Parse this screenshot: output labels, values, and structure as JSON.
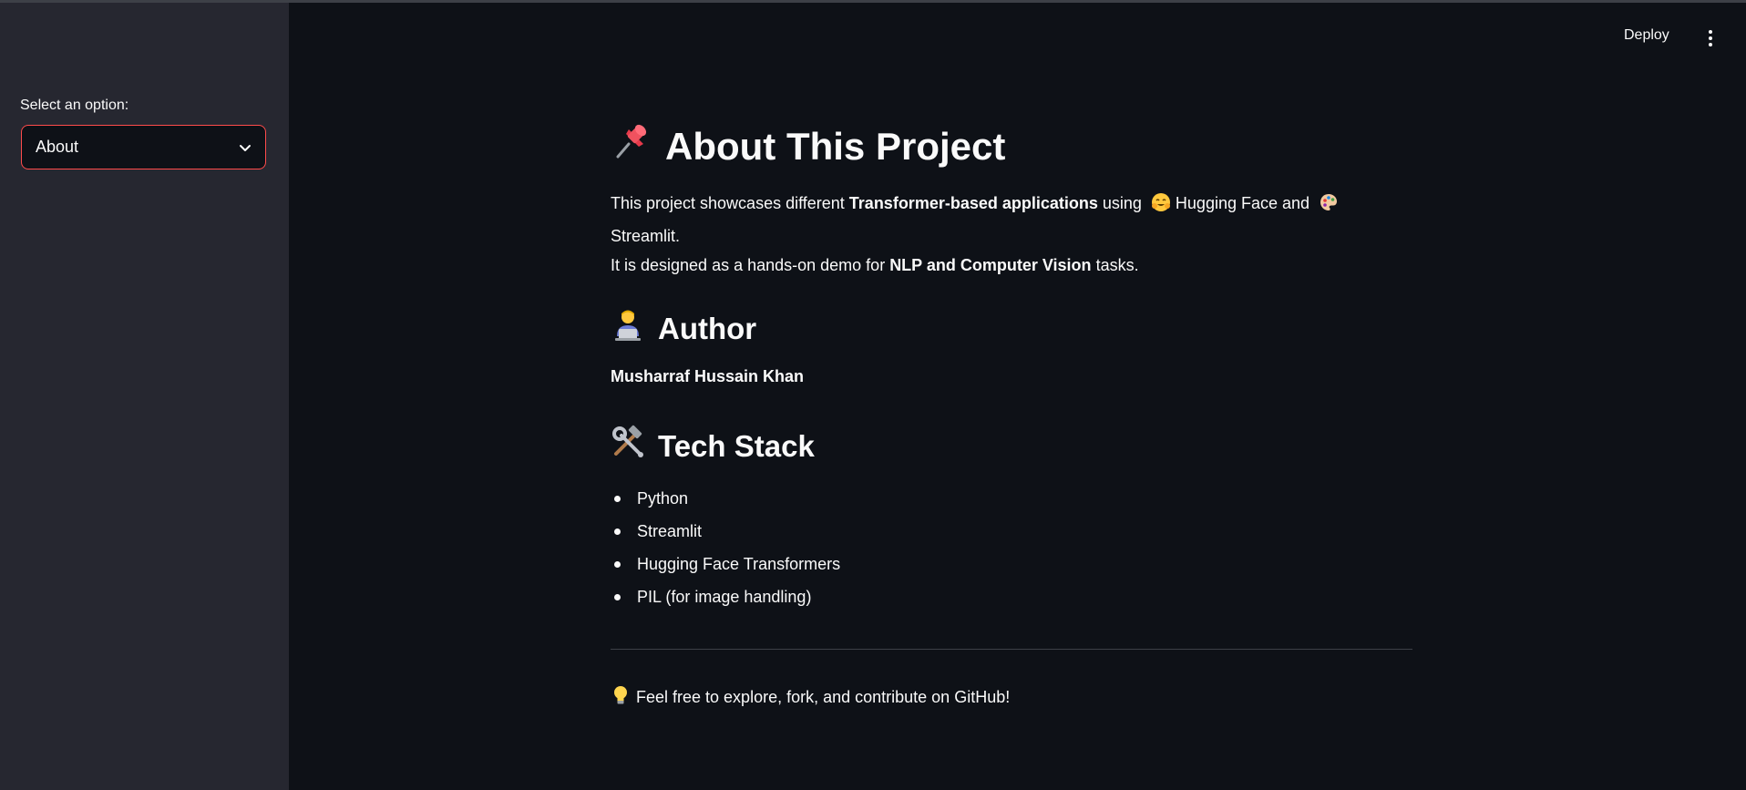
{
  "sidebar": {
    "select_label": "Select an option:",
    "select_value": "About"
  },
  "header": {
    "deploy_label": "Deploy"
  },
  "main": {
    "title": "About This Project",
    "intro": {
      "part1": "This project showcases different ",
      "bold1": "Transformer-based applications",
      "part2": " using ",
      "hf": "Hugging Face and",
      "streamlit": "Streamlit.",
      "line2_part1": "It is designed as a hands-on demo for ",
      "line2_bold": "NLP and Computer Vision",
      "line2_part2": " tasks."
    },
    "author_heading": "Author",
    "author_name": "Musharraf Hussain Khan",
    "tech_heading": "Tech Stack",
    "tech_items": [
      "Python",
      "Streamlit",
      "Hugging Face Transformers",
      "PIL (for image handling)"
    ],
    "footer_text": "Feel free to explore, fork, and contribute on GitHub!"
  },
  "icons": {
    "title": "pushpin-icon",
    "author": "technologist-icon",
    "tech": "hammer-wrench-icon",
    "hf": "hugging-face-icon",
    "palette": "palette-icon",
    "footer": "lightbulb-icon"
  },
  "colors": {
    "accent": "#ff4b4b",
    "background": "#0e1117",
    "sidebar": "#262730"
  }
}
